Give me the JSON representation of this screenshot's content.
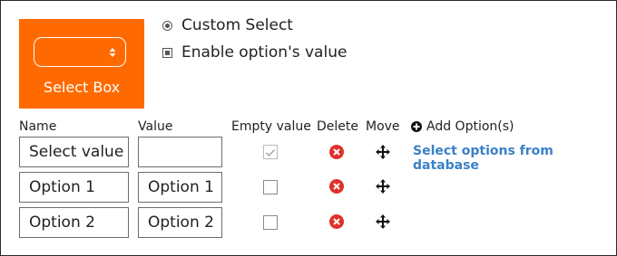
{
  "preview": {
    "label": "Select Box",
    "accent_color": "#ff6a00",
    "arrow_icon": "updown-arrows-icon"
  },
  "settings": {
    "custom_select_label": "Custom Select",
    "custom_select_checked": true,
    "enable_value_label": "Enable option's value",
    "enable_value_checked": true
  },
  "table": {
    "headers": {
      "name": "Name",
      "value": "Value",
      "empty_value": "Empty value",
      "delete": "Delete",
      "move": "Move"
    },
    "add_option_label": "Add Option(s)",
    "db_link_label": "Select options from database",
    "rows": [
      {
        "name": "Select value",
        "value": "",
        "empty": true
      },
      {
        "name": "Option 1",
        "value": "Option 1",
        "empty": false
      },
      {
        "name": "Option 2",
        "value": "Option 2",
        "empty": false
      }
    ],
    "delete_color": "#e0312b",
    "link_color": "#3a80c8"
  }
}
